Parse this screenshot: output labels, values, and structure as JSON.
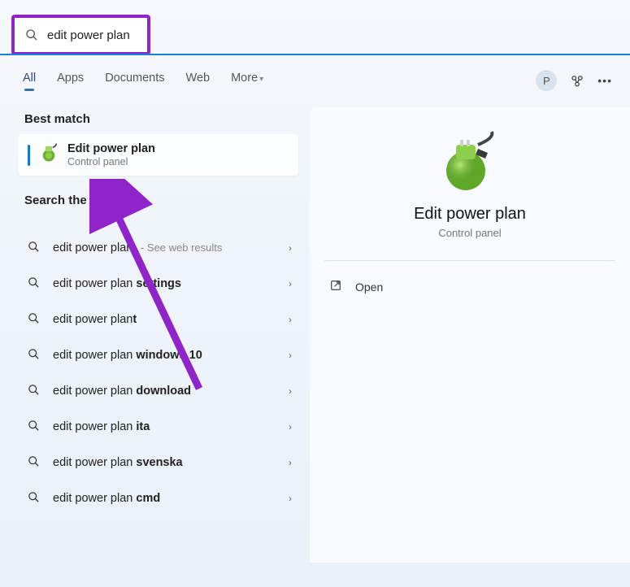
{
  "search": {
    "query": "edit power plan"
  },
  "tabs": {
    "all": "All",
    "apps": "Apps",
    "documents": "Documents",
    "web": "Web",
    "more": "More"
  },
  "header": {
    "avatar_initial": "P"
  },
  "sections": {
    "best_match": "Best match",
    "search_web": "Search the web"
  },
  "best_match_result": {
    "title": "Edit power plan",
    "subtitle": "Control panel"
  },
  "web_results": [
    {
      "prefix": "edit power plan",
      "highlight": "",
      "hint": "See web results"
    },
    {
      "prefix": "edit power plan ",
      "highlight": "settings",
      "hint": ""
    },
    {
      "prefix": "edit power plan",
      "highlight": "t",
      "hint": ""
    },
    {
      "prefix": "edit power plan ",
      "highlight": "windows 10",
      "hint": ""
    },
    {
      "prefix": "edit power plan ",
      "highlight": "download",
      "hint": ""
    },
    {
      "prefix": "edit power plan ",
      "highlight": "ita",
      "hint": ""
    },
    {
      "prefix": "edit power plan ",
      "highlight": "svenska",
      "hint": ""
    },
    {
      "prefix": "edit power plan ",
      "highlight": "cmd",
      "hint": ""
    }
  ],
  "preview": {
    "title": "Edit power plan",
    "subtitle": "Control panel",
    "open_label": "Open"
  },
  "colors": {
    "annotation": "#8e24c9"
  }
}
